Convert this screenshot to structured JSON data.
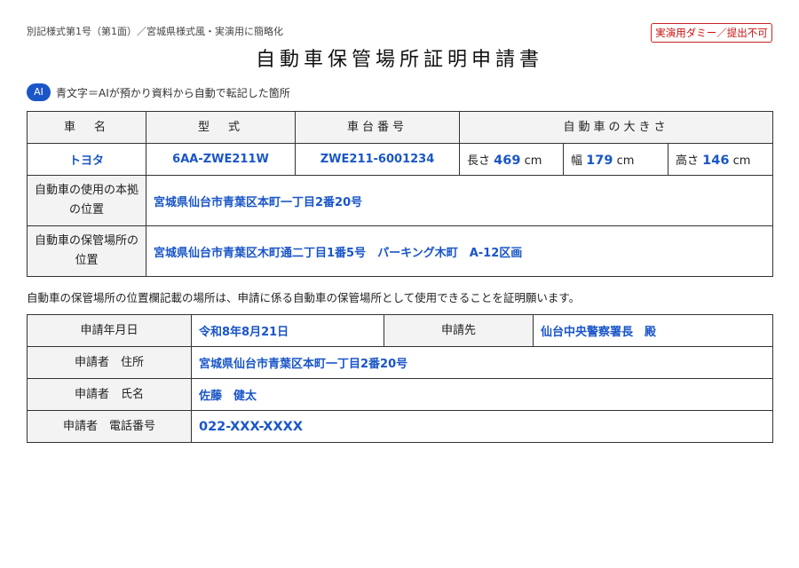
{
  "header": {
    "form_code": "別記様式第1号（第1面）／宮城県様式風・実演用に簡略化",
    "dummy_badge": "実演用ダミー／提出不可",
    "title": "自動車保管場所証明申請書"
  },
  "legend": {
    "badge": "AI",
    "text": "青文字＝AIが預かり資料から自動で転記した箇所"
  },
  "vehicle": {
    "headers": {
      "name": "車　名",
      "model": "型　式",
      "chassis": "車台番号",
      "size": "自動車の大きさ"
    },
    "name": "トヨタ",
    "model": "6AA-ZWE211W",
    "chassis": "ZWE211-6001234",
    "length_label": "長さ",
    "length": "469",
    "width_label": "幅",
    "width": "179",
    "height_label": "高さ",
    "height": "146",
    "unit": "cm",
    "base_location_label": "自動車の使用の本拠の位置",
    "base_location": "宮城県仙台市青葉区本町一丁目2番20号",
    "storage_location_label": "自動車の保管場所の位置",
    "storage_location": "宮城県仙台市青葉区木町通二丁目1番5号　パーキング木町　A-12区画"
  },
  "statement": "自動車の保管場所の位置欄記載の場所は、申請に係る自動車の保管場所として使用できることを証明願います。",
  "application": {
    "date_label": "申請年月日",
    "date": "令和8年8月21日",
    "dest_label": "申請先",
    "dest": "仙台中央警察署長　殿",
    "address_label": "申請者　住所",
    "address": "宮城県仙台市青葉区本町一丁目2番20号",
    "name_label": "申請者　氏名",
    "name": "佐藤　健太",
    "phone_label": "申請者　電話番号",
    "phone": "022-XXX-XXXX"
  },
  "colors": {
    "ai_blue": "#1a56c8",
    "badge_red": "#cc1111"
  }
}
